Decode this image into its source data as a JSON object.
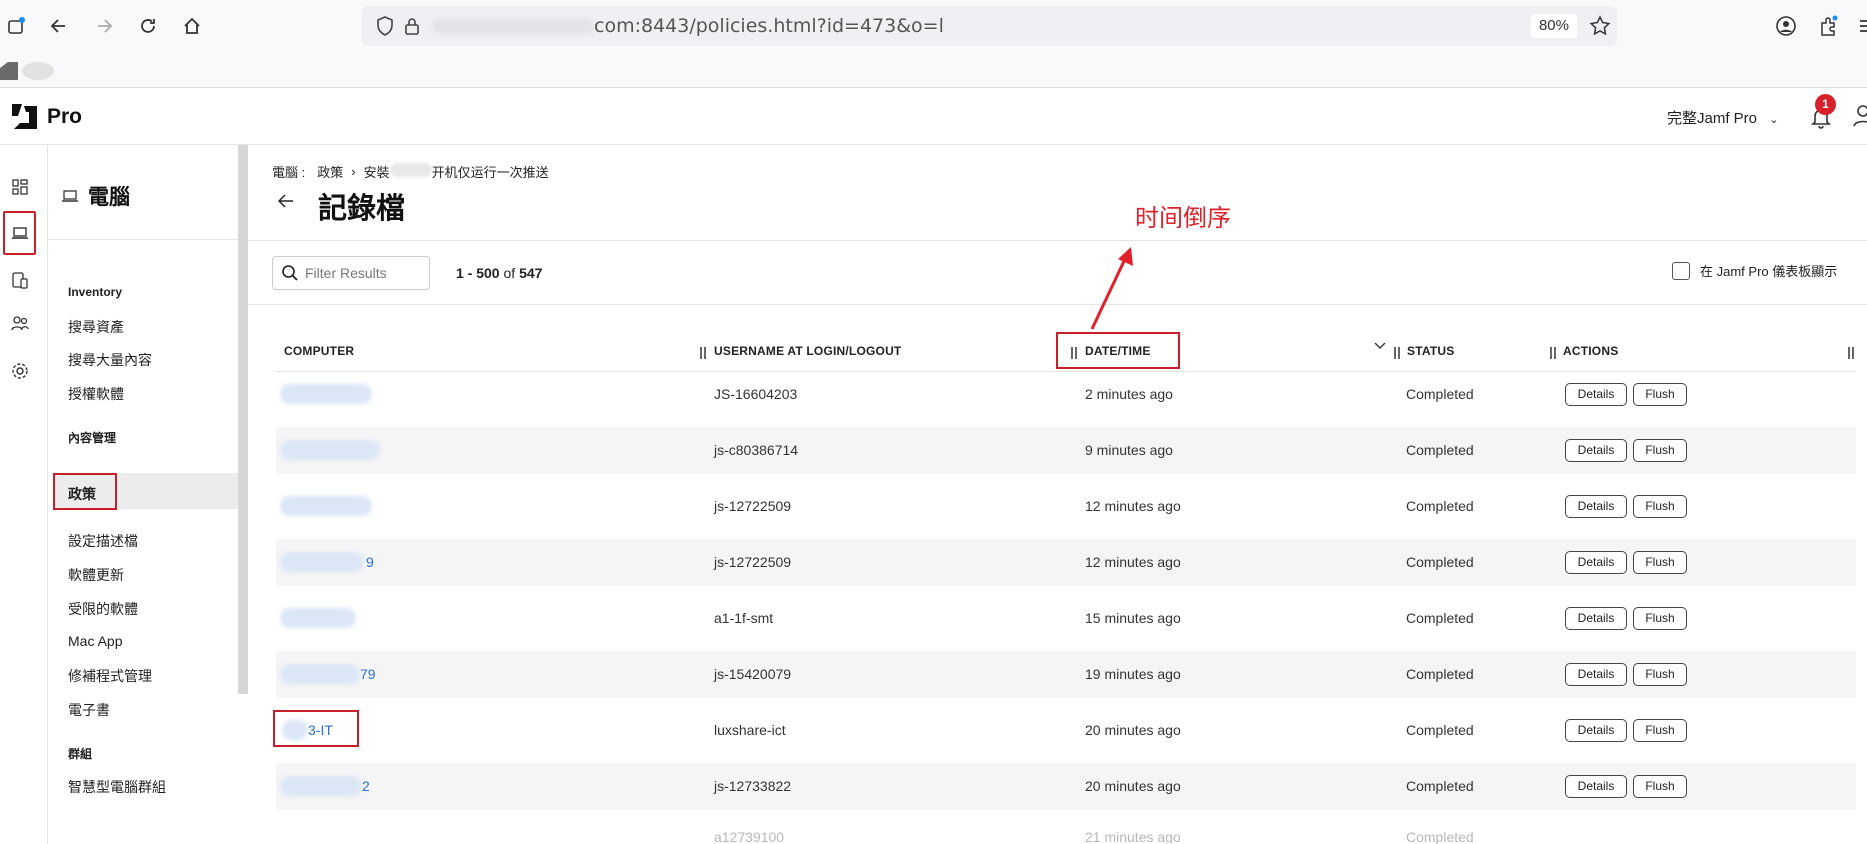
{
  "browser": {
    "url_visible": "com:8443/policies.html?id=473&o=l",
    "zoom": "80%"
  },
  "header": {
    "logo_text": "Pro",
    "site_select": "完整Jamf Pro",
    "notification_count": "1"
  },
  "sidenav": {
    "title": "電腦",
    "sections": [
      {
        "heading": "Inventory",
        "items": [
          "搜尋資產",
          "搜尋大量內容",
          "授權軟體"
        ]
      },
      {
        "heading": "內容管理",
        "items": [
          "政策",
          "設定描述檔",
          "軟體更新",
          "受限的軟體",
          "Mac App",
          "修補程式管理",
          "電子書"
        ]
      },
      {
        "heading": "群組",
        "items": [
          "智慧型電腦群組"
        ]
      }
    ],
    "active_item": "政策"
  },
  "breadcrumb": {
    "root": "電腦 :",
    "level1": "政策",
    "level2_prefix": "安裝",
    "level2_suffix": "开机仅运行一次推送"
  },
  "page": {
    "title": "記錄檔"
  },
  "toolbar": {
    "filter_placeholder": "Filter Results",
    "pager_range": "1 - 500",
    "pager_of": "of",
    "pager_total": "547",
    "dashboard_label": "在 Jamf Pro 儀表板顯示"
  },
  "annotation": {
    "text": "时间倒序",
    "color": "#e0202a"
  },
  "table": {
    "columns": [
      "COMPUTER",
      "USERNAME AT LOGIN/LOGOUT",
      "DATE/TIME",
      "STATUS",
      "ACTIONS"
    ],
    "details_label": "Details",
    "flush_label": "Flush",
    "rows": [
      {
        "computer_visible": "",
        "username": "JS-16604203",
        "datetime": "2 minutes ago",
        "status": "Completed"
      },
      {
        "computer_visible": "",
        "username": "js-c80386714",
        "datetime": "9 minutes ago",
        "status": "Completed"
      },
      {
        "computer_visible": "",
        "username": "js-12722509",
        "datetime": "12 minutes ago",
        "status": "Completed"
      },
      {
        "computer_visible": "9",
        "username": "js-12722509",
        "datetime": "12 minutes ago",
        "status": "Completed"
      },
      {
        "computer_visible": "",
        "username": "a1-1f-smt",
        "datetime": "15 minutes ago",
        "status": "Completed"
      },
      {
        "computer_visible": "79",
        "username": "js-15420079",
        "datetime": "19 minutes ago",
        "status": "Completed"
      },
      {
        "computer_visible": "3-IT",
        "username": "luxshare-ict",
        "datetime": "20 minutes ago",
        "status": "Completed"
      },
      {
        "computer_visible": "2",
        "username": "js-12733822",
        "datetime": "20 minutes ago",
        "status": "Completed"
      }
    ],
    "partial_row": {
      "username": "a12739100",
      "datetime": "21 minutes ago",
      "status": "Completed"
    }
  },
  "colors": {
    "accent_red": "#c7202b",
    "link_blue": "#2c6fd1",
    "badge_red": "#d6202a"
  }
}
